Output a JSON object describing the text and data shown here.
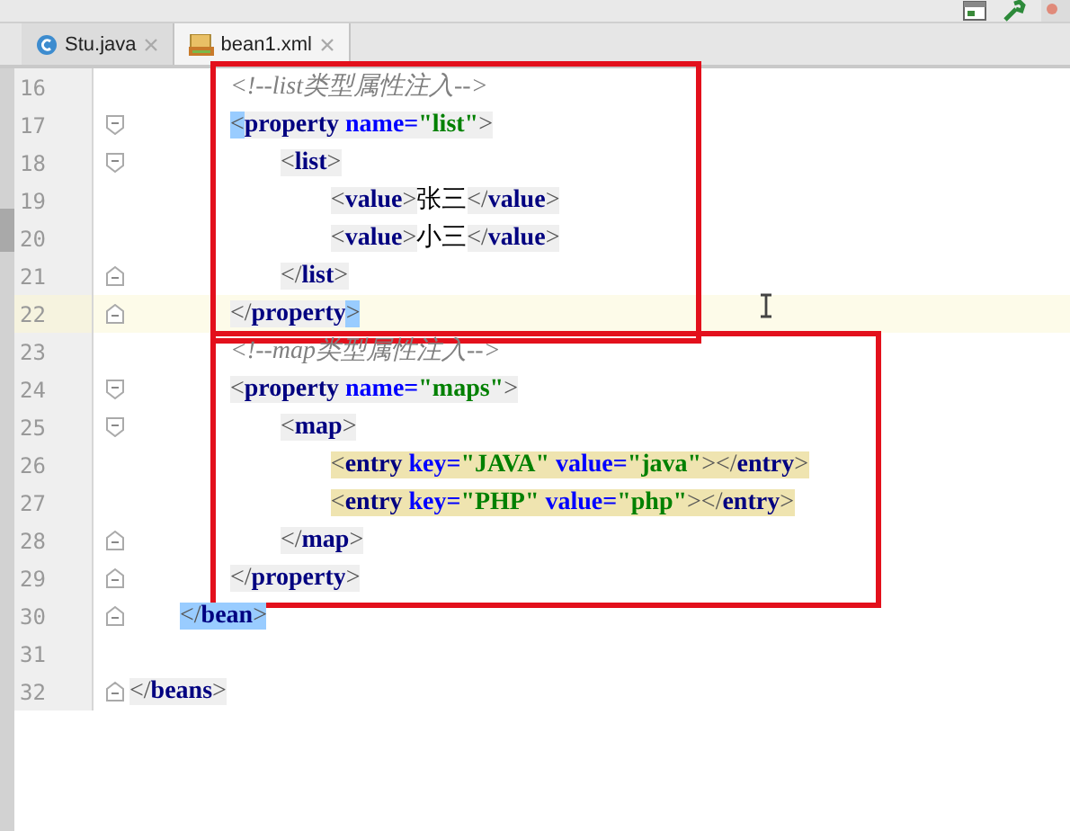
{
  "tabs": [
    {
      "label": "Stu.java",
      "selected": false
    },
    {
      "label": "bean1.xml",
      "selected": true
    }
  ],
  "blocks": [
    {
      "boxed": true,
      "lines": [
        {
          "number": "16",
          "kind": "plain",
          "current": false,
          "segments": [
            {
              "text": "        <!--list类型属性注入-->",
              "kind": "comment",
              "matched": false,
              "highlighted": false
            }
          ]
        },
        {
          "number": "17",
          "kind": "open",
          "current": false,
          "segments": [
            {
              "text": "        <",
              "kind": "bracket",
              "matched": true,
              "highlighted": false
            },
            {
              "text": "property",
              "kind": "tag",
              "matched": false,
              "highlighted": false
            },
            {
              "text": " name=",
              "kind": "attr",
              "matched": false,
              "highlighted": false
            },
            {
              "text": "\"list\"",
              "kind": "string",
              "matched": false,
              "highlighted": false
            },
            {
              "text": ">",
              "kind": "bracket",
              "matched": false,
              "highlighted": false
            }
          ]
        },
        {
          "number": "18",
          "kind": "open",
          "current": false,
          "segments": [
            {
              "text": "            <",
              "kind": "bracket",
              "matched": false,
              "highlighted": false
            },
            {
              "text": "list",
              "kind": "tag",
              "matched": false,
              "highlighted": false
            },
            {
              "text": ">",
              "kind": "bracket",
              "matched": false,
              "highlighted": false
            }
          ]
        },
        {
          "number": "19",
          "kind": "plain",
          "current": false,
          "segments": [
            {
              "text": "                <",
              "kind": "bracket",
              "matched": false,
              "highlighted": false
            },
            {
              "text": "value",
              "kind": "tag",
              "matched": false,
              "highlighted": false
            },
            {
              "text": ">",
              "kind": "bracket",
              "matched": false,
              "highlighted": false
            },
            {
              "text": "张三",
              "kind": "text",
              "matched": false,
              "highlighted": false
            },
            {
              "text": "</",
              "kind": "bracket",
              "matched": false,
              "highlighted": false
            },
            {
              "text": "value",
              "kind": "tag",
              "matched": false,
              "highlighted": false
            },
            {
              "text": ">",
              "kind": "bracket",
              "matched": false,
              "highlighted": false
            }
          ]
        },
        {
          "number": "20",
          "kind": "plain",
          "current": false,
          "segments": [
            {
              "text": "                <",
              "kind": "bracket",
              "matched": false,
              "highlighted": false
            },
            {
              "text": "value",
              "kind": "tag",
              "matched": false,
              "highlighted": false
            },
            {
              "text": ">",
              "kind": "bracket",
              "matched": false,
              "highlighted": false
            },
            {
              "text": "小三",
              "kind": "text",
              "matched": false,
              "highlighted": false
            },
            {
              "text": "</",
              "kind": "bracket",
              "matched": false,
              "highlighted": false
            },
            {
              "text": "value",
              "kind": "tag",
              "matched": false,
              "highlighted": false
            },
            {
              "text": ">",
              "kind": "bracket",
              "matched": false,
              "highlighted": false
            }
          ]
        },
        {
          "number": "21",
          "kind": "close",
          "current": false,
          "segments": [
            {
              "text": "            </",
              "kind": "bracket",
              "matched": false,
              "highlighted": false
            },
            {
              "text": "list",
              "kind": "tag",
              "matched": false,
              "highlighted": false
            },
            {
              "text": ">",
              "kind": "bracket",
              "matched": false,
              "highlighted": false
            }
          ]
        },
        {
          "number": "22",
          "kind": "close",
          "current": true,
          "segments": [
            {
              "text": "        </",
              "kind": "bracket",
              "matched": false,
              "highlighted": false
            },
            {
              "text": "property",
              "kind": "tag",
              "matched": false,
              "highlighted": false
            },
            {
              "text": ">",
              "kind": "bracket",
              "matched": true,
              "highlighted": false
            }
          ]
        }
      ]
    },
    {
      "boxed": true,
      "lines": [
        {
          "number": "23",
          "kind": "plain",
          "current": false,
          "segments": [
            {
              "text": "        <!--map类型属性注入-->",
              "kind": "comment",
              "matched": false,
              "highlighted": false
            }
          ]
        },
        {
          "number": "24",
          "kind": "open",
          "current": false,
          "segments": [
            {
              "text": "        <",
              "kind": "bracket",
              "matched": false,
              "highlighted": false
            },
            {
              "text": "property",
              "kind": "tag",
              "matched": false,
              "highlighted": false
            },
            {
              "text": " name=",
              "kind": "attr",
              "matched": false,
              "highlighted": false
            },
            {
              "text": "\"maps\"",
              "kind": "string",
              "matched": false,
              "highlighted": false
            },
            {
              "text": ">",
              "kind": "bracket",
              "matched": false,
              "highlighted": false
            }
          ]
        },
        {
          "number": "25",
          "kind": "open",
          "current": false,
          "segments": [
            {
              "text": "            <",
              "kind": "bracket",
              "matched": false,
              "highlighted": false
            },
            {
              "text": "map",
              "kind": "tag",
              "matched": false,
              "highlighted": false
            },
            {
              "text": ">",
              "kind": "bracket",
              "matched": false,
              "highlighted": false
            }
          ]
        },
        {
          "number": "26",
          "kind": "plain",
          "current": false,
          "segments": [
            {
              "text": "                <",
              "kind": "bracket",
              "matched": false,
              "highlighted": true
            },
            {
              "text": "entry",
              "kind": "tag",
              "matched": false,
              "highlighted": true
            },
            {
              "text": " key=",
              "kind": "attr",
              "matched": false,
              "highlighted": true
            },
            {
              "text": "\"JAVA\"",
              "kind": "string",
              "matched": false,
              "highlighted": true
            },
            {
              "text": " value=",
              "kind": "attr",
              "matched": false,
              "highlighted": true
            },
            {
              "text": "\"java\"",
              "kind": "string",
              "matched": false,
              "highlighted": true
            },
            {
              "text": "></",
              "kind": "bracket",
              "matched": false,
              "highlighted": true
            },
            {
              "text": "entry",
              "kind": "tag",
              "matched": false,
              "highlighted": true
            },
            {
              "text": ">",
              "kind": "bracket",
              "matched": false,
              "highlighted": true
            }
          ]
        },
        {
          "number": "27",
          "kind": "plain",
          "current": false,
          "segments": [
            {
              "text": "                <",
              "kind": "bracket",
              "matched": false,
              "highlighted": true
            },
            {
              "text": "entry",
              "kind": "tag",
              "matched": false,
              "highlighted": true
            },
            {
              "text": " key=",
              "kind": "attr",
              "matched": false,
              "highlighted": true
            },
            {
              "text": "\"PHP\"",
              "kind": "string",
              "matched": false,
              "highlighted": true
            },
            {
              "text": " value=",
              "kind": "attr",
              "matched": false,
              "highlighted": true
            },
            {
              "text": "\"php\"",
              "kind": "string",
              "matched": false,
              "highlighted": true
            },
            {
              "text": "></",
              "kind": "bracket",
              "matched": false,
              "highlighted": true
            },
            {
              "text": "entry",
              "kind": "tag",
              "matched": false,
              "highlighted": true
            },
            {
              "text": ">",
              "kind": "bracket",
              "matched": false,
              "highlighted": true
            }
          ]
        },
        {
          "number": "28",
          "kind": "close",
          "current": false,
          "segments": [
            {
              "text": "            </",
              "kind": "bracket",
              "matched": false,
              "highlighted": false
            },
            {
              "text": "map",
              "kind": "tag",
              "matched": false,
              "highlighted": false
            },
            {
              "text": ">",
              "kind": "bracket",
              "matched": false,
              "highlighted": false
            }
          ]
        },
        {
          "number": "29",
          "kind": "close",
          "current": false,
          "segments": [
            {
              "text": "        </",
              "kind": "bracket",
              "matched": false,
              "highlighted": false
            },
            {
              "text": "property",
              "kind": "tag",
              "matched": false,
              "highlighted": false
            },
            {
              "text": ">",
              "kind": "bracket",
              "matched": false,
              "highlighted": false
            }
          ]
        }
      ]
    },
    {
      "boxed": false,
      "lines": [
        {
          "number": "30",
          "kind": "close",
          "current": false,
          "segments": [
            {
              "text": "    </",
              "kind": "bracket",
              "matched": true,
              "highlighted": false
            },
            {
              "text": "bean",
              "kind": "tag",
              "matched": true,
              "highlighted": false
            },
            {
              "text": ">",
              "kind": "bracket",
              "matched": true,
              "highlighted": false
            }
          ]
        },
        {
          "number": "31",
          "kind": "plain",
          "current": false
        },
        {
          "number": "32",
          "kind": "close",
          "current": false,
          "segments": [
            {
              "text": "</",
              "kind": "bracket",
              "matched": false,
              "highlighted": false
            },
            {
              "text": "beans",
              "kind": "tag",
              "matched": false,
              "highlighted": false
            },
            {
              "text": ">",
              "kind": "bracket",
              "matched": false,
              "highlighted": false
            }
          ]
        }
      ]
    }
  ]
}
